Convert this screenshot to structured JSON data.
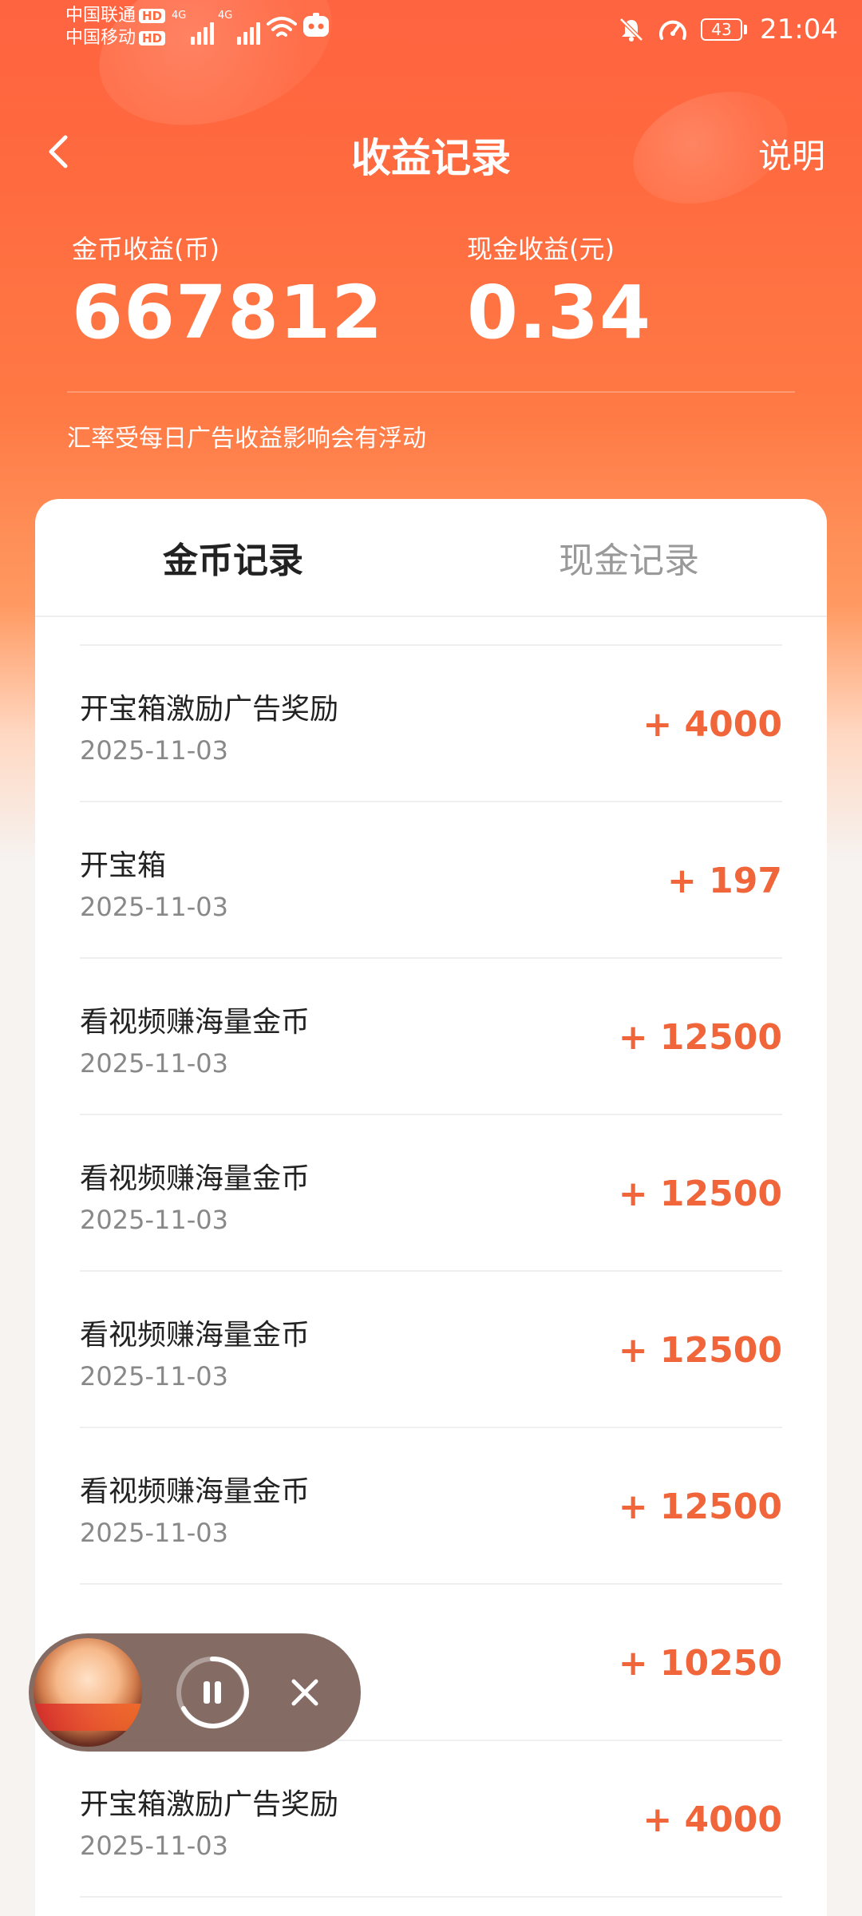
{
  "status_bar": {
    "carrier_1": "中国联通",
    "carrier_2": "中国移动",
    "hd_badge": "HD",
    "network_1": "4G",
    "network_2": "4G",
    "battery": "43",
    "time": "21:04"
  },
  "header": {
    "title": "收益记录",
    "help_label": "说明"
  },
  "summary": {
    "coin_label": "金币收益(币)",
    "coin_value": "667812",
    "cash_label": "现金收益(元)",
    "cash_value": "0.34",
    "note": "汇率受每日广告收益影响会有浮动"
  },
  "tabs": [
    {
      "label": "金币记录",
      "active": true
    },
    {
      "label": "现金记录",
      "active": false
    }
  ],
  "records": [
    {
      "title": "开宝箱激励广告奖励",
      "date": "2025-11-03",
      "amount": "+ 4000"
    },
    {
      "title": "开宝箱",
      "date": "2025-11-03",
      "amount": "+ 197"
    },
    {
      "title": "看视频赚海量金币",
      "date": "2025-11-03",
      "amount": "+ 12500"
    },
    {
      "title": "看视频赚海量金币",
      "date": "2025-11-03",
      "amount": "+ 12500"
    },
    {
      "title": "看视频赚海量金币",
      "date": "2025-11-03",
      "amount": "+ 12500"
    },
    {
      "title": "看视频赚海量金币",
      "date": "2025-11-03",
      "amount": "+ 12500"
    },
    {
      "title": "",
      "date": "",
      "amount": "+ 10250"
    },
    {
      "title": "开宝箱激励广告奖励",
      "date": "2025-11-03",
      "amount": "+ 4000"
    }
  ],
  "colors": {
    "accent": "#ff6a41",
    "amount": "#f0663a"
  },
  "icons": {
    "back": "chevron-left-icon",
    "pause": "pause-icon",
    "close": "close-icon",
    "mute": "bell-off-icon",
    "speed": "speedometer-icon",
    "wifi": "wifi-icon"
  }
}
